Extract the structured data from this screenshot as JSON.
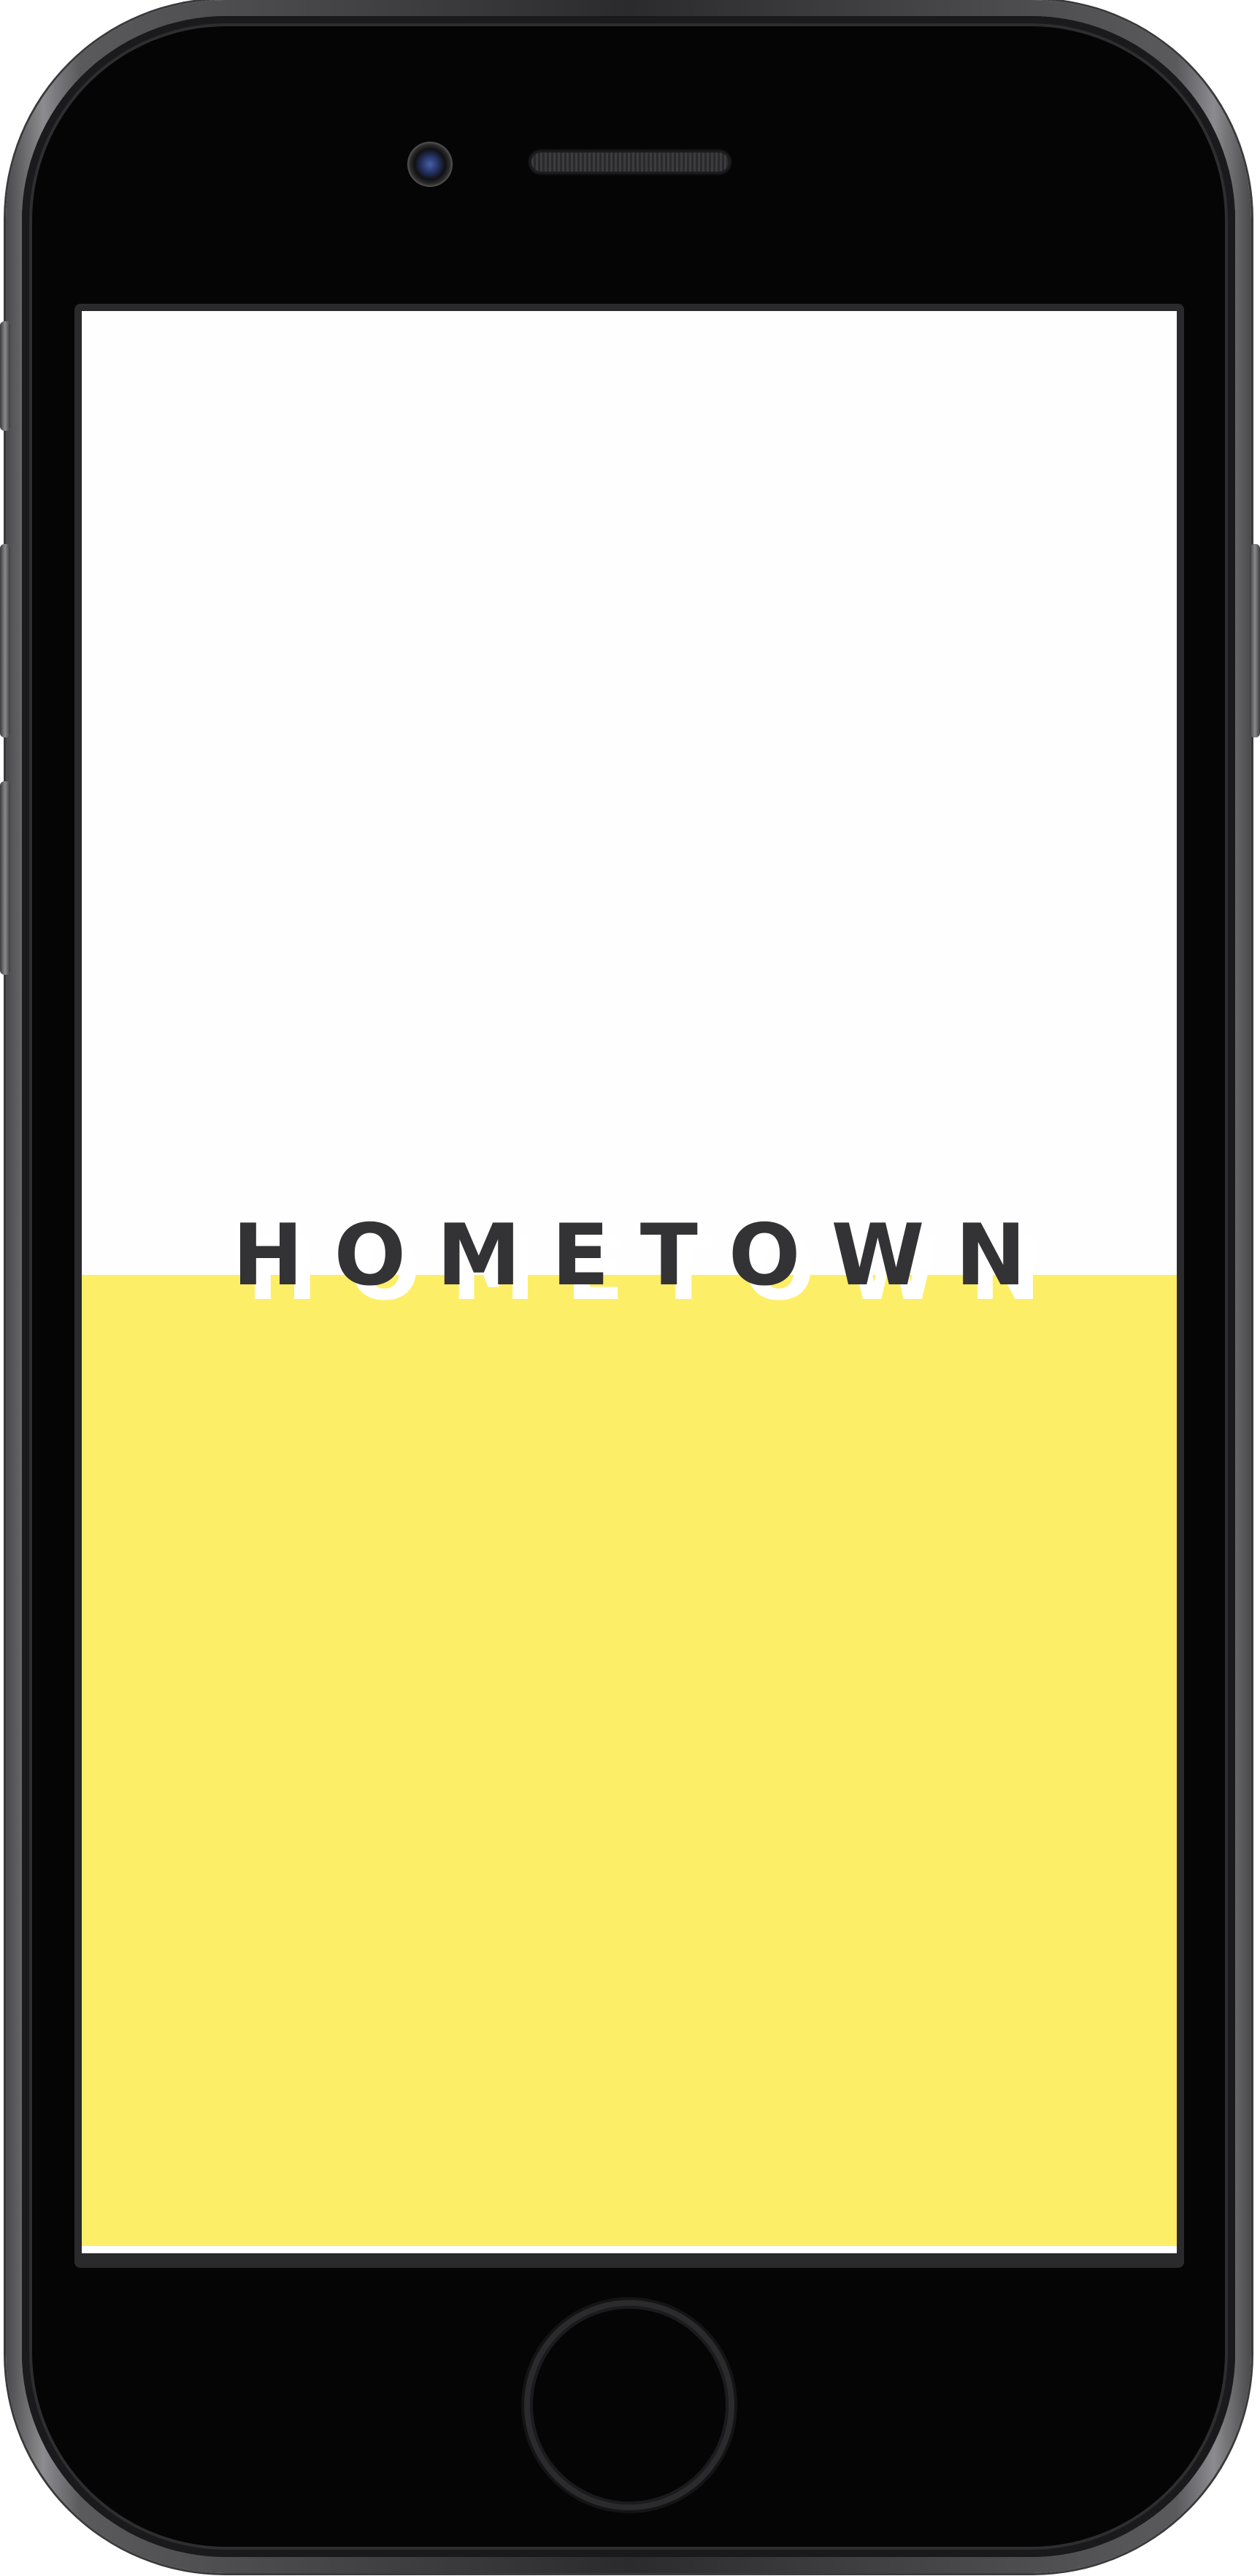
{
  "app": {
    "logo_text": "HOMETOWN"
  },
  "colors": {
    "accent_yellow": "#fdee67",
    "logo_text": "#333335",
    "background": "#fefefe",
    "device_body": "#2b2b2d"
  },
  "icons": {
    "front_camera": "camera-icon",
    "earpiece": "speaker-grille",
    "home": "home-button"
  }
}
